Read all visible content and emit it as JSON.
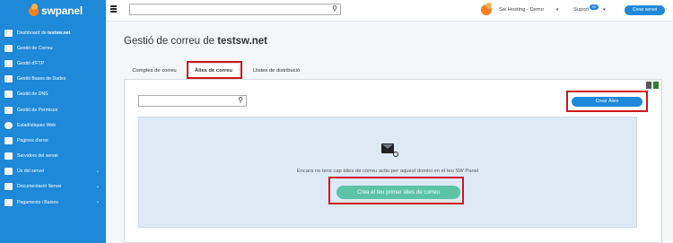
{
  "brand": {
    "name": "swpanel"
  },
  "sidebar": {
    "items": [
      {
        "prefix": "Dashboard de ",
        "bold": "testsw.net",
        "icon": "dashboard-icon",
        "has_chevron": false
      },
      {
        "prefix": "Gestió de Correu",
        "bold": "",
        "icon": "mail-icon",
        "has_chevron": false
      },
      {
        "prefix": "Gestió d'FTP",
        "bold": "",
        "icon": "ftp-icon",
        "has_chevron": false
      },
      {
        "prefix": "Gestió Bases de Dades",
        "bold": "",
        "icon": "database-icon",
        "has_chevron": false
      },
      {
        "prefix": "Gestió de DNS",
        "bold": "",
        "icon": "flag-icon",
        "has_chevron": false
      },
      {
        "prefix": "Gestió de Permisos",
        "bold": "",
        "icon": "permissions-icon",
        "has_chevron": false
      },
      {
        "prefix": "Estadístiques Web",
        "bold": "",
        "icon": "pie-chart-icon",
        "has_chevron": false
      },
      {
        "prefix": "Pàgines d'error",
        "bold": "",
        "icon": "document-icon",
        "has_chevron": false
      },
      {
        "prefix": "Servidors del servei",
        "bold": "",
        "icon": "servers-icon",
        "has_chevron": false
      },
      {
        "prefix": "Ús del servei",
        "bold": "",
        "icon": "usage-icon",
        "has_chevron": true
      },
      {
        "prefix": "Documentació Servei",
        "bold": "",
        "icon": "documentation-icon",
        "has_chevron": true
      },
      {
        "prefix": "Pagaments i Baixes",
        "bold": "",
        "icon": "payments-icon",
        "has_chevron": true
      }
    ]
  },
  "topbar": {
    "search_placeholder": "",
    "org_name": "Sw Hosting - Demo",
    "support_label": "Suport",
    "support_badge": "99",
    "create_server_label": "Crear servei"
  },
  "page": {
    "title_prefix": "Gestió de correu de ",
    "title_domain": "testsw.net",
    "tabs": [
      "Comptes de correu",
      "Àlies de correu",
      "Llistes de distribució"
    ],
    "active_tab": 1
  },
  "panel": {
    "search_placeholder": "",
    "create_alias_label": "Crear Àlies",
    "empty_message": "Encara no tens cap àlies de correu actiu per aquest domini en el teu SW Panel",
    "create_first_label": "Crea el teu primer àlies de correu"
  },
  "colors": {
    "primary": "#1e88d9",
    "accent_orange": "#f6821f",
    "success": "#5dc3a6",
    "highlight": "#d0151c",
    "empty_bg": "#dde9f5"
  }
}
